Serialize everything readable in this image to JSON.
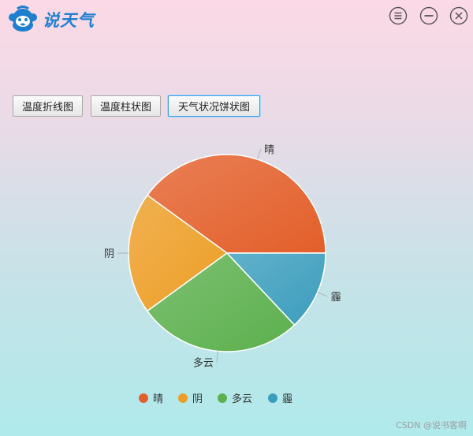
{
  "app": {
    "title": "说天气",
    "colors": {
      "brand": "#1e7fd0",
      "active_border": "#3ba0e6"
    }
  },
  "window_controls": [
    {
      "name": "menu-icon"
    },
    {
      "name": "minimize-icon"
    },
    {
      "name": "close-icon"
    }
  ],
  "tabs": [
    {
      "label": "温度折线图",
      "active": false
    },
    {
      "label": "温度柱状图",
      "active": false
    },
    {
      "label": "天气状况饼状图",
      "active": true
    }
  ],
  "chart_data": {
    "type": "pie",
    "title": "",
    "categories": [
      "晴",
      "阴",
      "多云",
      "霾"
    ],
    "values": [
      40,
      20,
      27,
      13
    ],
    "colors": [
      "#e35f2a",
      "#ed9e26",
      "#5cb04e",
      "#3b9dbd"
    ],
    "legend": "bottom-center"
  },
  "watermark": "CSDN @说书客啊"
}
